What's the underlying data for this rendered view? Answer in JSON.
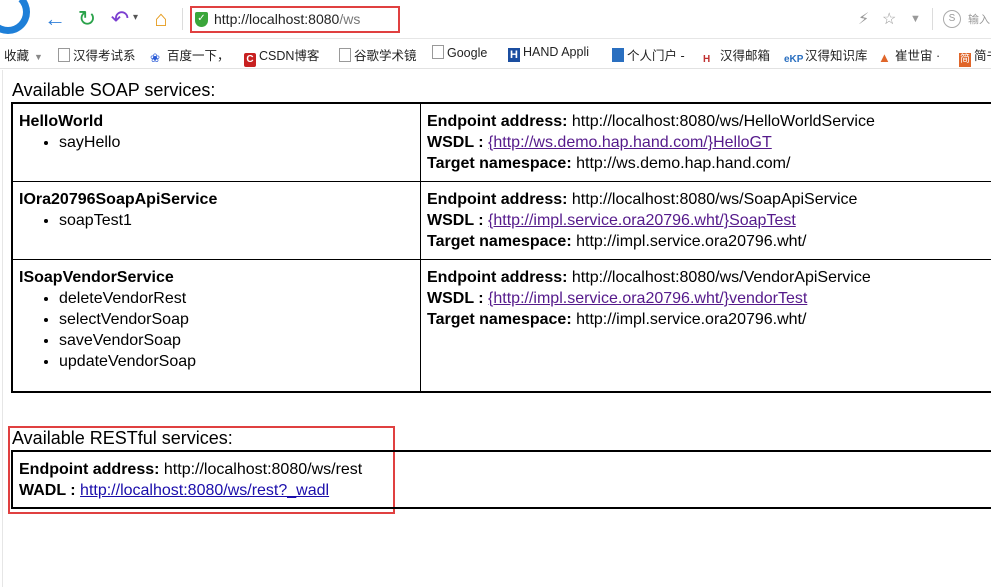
{
  "browser": {
    "url_host": "http://localhost:8080",
    "url_path": "/ws",
    "search_placeholder": "输入",
    "icons": {
      "back": "back-arrow-icon",
      "refresh": "refresh-icon",
      "undo": "undo-icon",
      "home": "home-icon",
      "secure": "shield-icon",
      "speed": "lightning-icon",
      "favorite": "star-icon",
      "search_engine": "search-engine-icon"
    },
    "colors": {
      "highlight": "#e04040",
      "back": "#2f7fd9",
      "refresh": "#2aa24a",
      "undo": "#7b3fd0",
      "home": "#e59a1a",
      "visited_link": "#551a8b",
      "link": "#1a0dab"
    }
  },
  "bookmarks": [
    {
      "label": "收藏",
      "icon": "none",
      "caret": true
    },
    {
      "label": "汉得考试系",
      "icon": "doc"
    },
    {
      "label": "百度一下，",
      "icon": "paw"
    },
    {
      "label": "CSDN博客",
      "icon": "csdn"
    },
    {
      "label": "谷歌学术镜",
      "icon": "doc"
    },
    {
      "label": "Google",
      "icon": "doc"
    },
    {
      "label": "HAND Appli",
      "icon": "hand"
    },
    {
      "label": "个人门户 -",
      "icon": "portal"
    },
    {
      "label": "汉得邮箱",
      "icon": "mail"
    },
    {
      "label": "汉得知识库",
      "icon": "ekp"
    },
    {
      "label": "崔世宙 ·",
      "icon": "fox"
    },
    {
      "label": "简书",
      "icon": "jian"
    }
  ],
  "soap": {
    "title": "Available SOAP services:",
    "services": [
      {
        "name": "HelloWorld",
        "operations": [
          "sayHello"
        ],
        "endpoint_label": "Endpoint address:",
        "endpoint": "http://localhost:8080/ws/HelloWorldService",
        "wsdl_label": "WSDL :",
        "wsdl": "{http://ws.demo.hap.hand.com/}HelloGT",
        "ns_label": "Target namespace:",
        "namespace": "http://ws.demo.hap.hand.com/"
      },
      {
        "name": "IOra20796SoapApiService",
        "operations": [
          "soapTest1"
        ],
        "endpoint_label": "Endpoint address:",
        "endpoint": "http://localhost:8080/ws/SoapApiService",
        "wsdl_label": "WSDL :",
        "wsdl": "{http://impl.service.ora20796.wht/}SoapTest",
        "ns_label": "Target namespace:",
        "namespace": "http://impl.service.ora20796.wht/"
      },
      {
        "name": "ISoapVendorService",
        "operations": [
          "deleteVendorRest",
          "selectVendorSoap",
          "saveVendorSoap",
          "updateVendorSoap"
        ],
        "endpoint_label": "Endpoint address:",
        "endpoint": "http://localhost:8080/ws/VendorApiService",
        "wsdl_label": "WSDL :",
        "wsdl": "{http://impl.service.ora20796.wht/}vendorTest",
        "ns_label": "Target namespace:",
        "namespace": "http://impl.service.ora20796.wht/"
      }
    ]
  },
  "rest": {
    "title": "Available RESTful services:",
    "endpoint_label": "Endpoint address:",
    "endpoint": "http://localhost:8080/ws/rest",
    "wadl_label": "WADL :",
    "wadl": "http://localhost:8080/ws/rest?_wadl"
  }
}
